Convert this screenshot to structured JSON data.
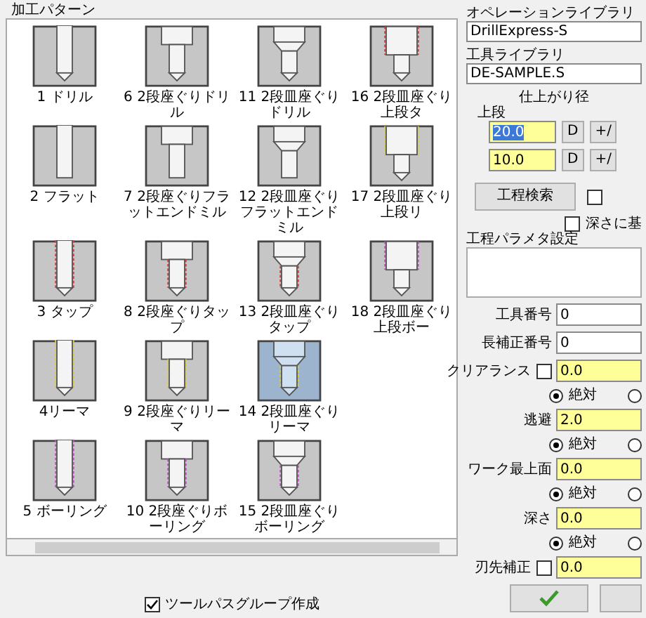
{
  "patterns_group": {
    "title": "加工パターン",
    "pattern_columns": [
      {
        "kind": "single",
        "patterns": [
          {
            "label": "1 ドリル",
            "kind": "drill",
            "selected": false
          },
          {
            "label": "2 フラット",
            "kind": "flat",
            "selected": false
          },
          {
            "label": "3 タップ",
            "kind": "tap",
            "selected": false
          },
          {
            "label": "4リーマ",
            "kind": "reamer",
            "selected": false
          },
          {
            "label": "5 ボーリング",
            "kind": "boring",
            "selected": false
          }
        ]
      },
      {
        "kind": "counterbore",
        "patterns": [
          {
            "label": "6 2段座ぐりドリル",
            "kind": "drill",
            "selected": false
          },
          {
            "label": "7 2段座ぐりフラットエンドミル",
            "kind": "flat",
            "selected": false
          },
          {
            "label": "8 2段座ぐりタップ",
            "kind": "tap",
            "selected": false
          },
          {
            "label": "9 2段座ぐりリーマ",
            "kind": "reamer",
            "selected": false
          },
          {
            "label": "10 2段座ぐりボーリング",
            "kind": "boring",
            "selected": false
          }
        ]
      },
      {
        "kind": "countersunk",
        "patterns": [
          {
            "label": "11 2段皿座ぐりドリル",
            "kind": "drill",
            "selected": false
          },
          {
            "label": "12 2段皿座ぐりフラットエンドミル",
            "kind": "flat",
            "selected": false
          },
          {
            "label": "13 2段皿座ぐりタップ",
            "kind": "tap",
            "selected": false
          },
          {
            "label": "14 2段皿座ぐりリーマ",
            "kind": "reamer",
            "selected": true
          },
          {
            "label": "15 2段皿座ぐりボーリング",
            "kind": "boring",
            "selected": false
          }
        ]
      },
      {
        "kind": "upper",
        "patterns": [
          {
            "label": "16 2段皿座ぐり上段タ",
            "kind": "tap",
            "selected": false
          },
          {
            "label": "17 2段皿座ぐり上段リ",
            "kind": "reamer",
            "selected": false
          },
          {
            "label": "18 2段皿座ぐり上段ボー",
            "kind": "boring",
            "selected": false
          }
        ]
      }
    ],
    "toolpath_group_checkbox": {
      "label": "ツールパスグループ作成",
      "checked": true
    }
  },
  "operation_library": {
    "label": "オペレーションライブラリ",
    "value": "DrillExpress-S"
  },
  "tool_library": {
    "label": "工具ライブラリ",
    "value": "DE-SAMPLE.S"
  },
  "finish_diameter": {
    "title": "仕上がり径",
    "group_label": "上段",
    "rows": [
      {
        "value": "20.0",
        "highlighted": true,
        "d_button": "D",
        "tolerance_button": "+/"
      },
      {
        "value": "10.0",
        "highlighted": false,
        "d_button": "D",
        "tolerance_button": "+/"
      }
    ]
  },
  "search_button": "工程検索",
  "side_checkbox": {
    "checked": false
  },
  "depth_checkbox": {
    "label": "深さに基",
    "checked": false
  },
  "params_title": "工程パラメタ設定",
  "params": [
    {
      "kind": "number",
      "label": "工具番号",
      "value": "0"
    },
    {
      "kind": "number",
      "label": "長補正番号",
      "value": "0"
    },
    {
      "kind": "coord",
      "label": "クリアランス",
      "checkbox": false,
      "value": "0.0",
      "options": [
        {
          "label": "絶対",
          "selected": true
        },
        {
          "selected": false
        }
      ]
    },
    {
      "kind": "coord",
      "label": "逃避",
      "value": "2.0",
      "options": [
        {
          "label": "絶対",
          "selected": true
        },
        {
          "selected": false
        }
      ]
    },
    {
      "kind": "coord",
      "label": "ワーク最上面",
      "value": "0.0",
      "options": [
        {
          "label": "絶対",
          "selected": true
        },
        {
          "selected": false
        }
      ]
    },
    {
      "kind": "coord",
      "label": "深さ",
      "value": "0.0",
      "options": [
        {
          "label": "絶対",
          "selected": true
        },
        {
          "selected": false
        }
      ]
    },
    {
      "kind": "number",
      "label": "刃先補正",
      "checkbox": false,
      "value": "0.0",
      "yellow": true
    }
  ]
}
